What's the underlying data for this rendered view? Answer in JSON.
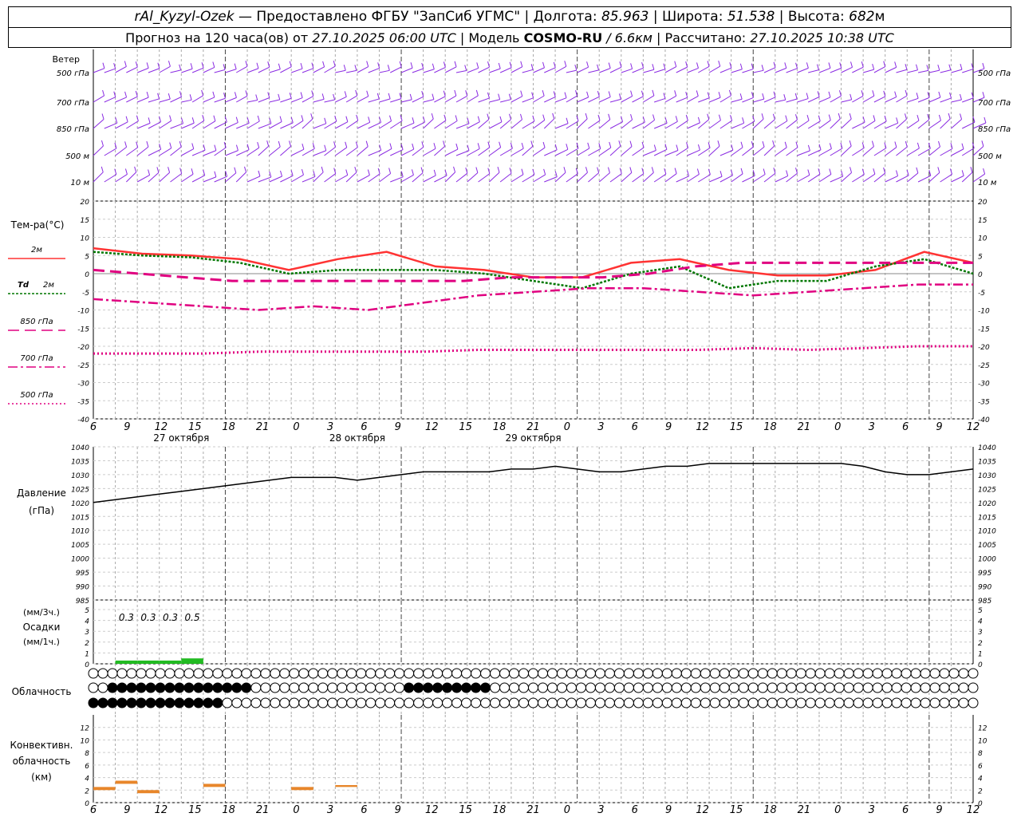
{
  "header": {
    "station": "rAl_Kyzyl-Ozek",
    "provider": " — Предоставлено ФГБУ \"ЗапСиб УГМС\" | Долгота: ",
    "lon": "85.963",
    "lat_label": " | Широта: ",
    "lat": "51.538",
    "alt_label": " | Высота: ",
    "alt": "682",
    "alt_unit": "м",
    "fc_label": "Прогноз на 120 часа(ов) от ",
    "fc_time": "27.10.2025 06:00 UTC",
    "model_label": " | Модель ",
    "model": "COSMO-RU",
    "model_res": " / 6.6км",
    "calc_label": " | Рассчитано: ",
    "calc_time": "27.10.2025 10:38 UTC"
  },
  "time_axis": {
    "ticks": [
      "6",
      "9",
      "12",
      "15",
      "18",
      "21",
      "0",
      "3",
      "6",
      "9",
      "12",
      "15",
      "18",
      "21",
      "0",
      "3",
      "6",
      "9",
      "12",
      "15",
      "18",
      "21",
      "0",
      "3",
      "6",
      "9",
      "12"
    ],
    "dates": [
      "27 октября",
      "28 октября",
      "29 октября"
    ]
  },
  "wind": {
    "title": "Ветер",
    "levels": [
      "500 гПа",
      "700 гПа",
      "850 гПа",
      "500 м",
      "10  м"
    ]
  },
  "labels": {
    "temp": "Тем-ра(°С)",
    "t2m": "2м",
    "td": "Td",
    "td2": "2м",
    "t850": "850 гПа",
    "t700": "700 гПа",
    "t500": "500 гПа",
    "pres1": "Давление",
    "pres2": "(гПа)",
    "precip1": "(мм/3ч.)",
    "precip2": "Осадки",
    "precip3": "(мм/1ч.)",
    "cloud": "Облачность",
    "conv1": "Конвективн.",
    "conv2": "облачность",
    "conv3": "(км)"
  },
  "colors": {
    "t2m": "#ff3333",
    "td": "#007700",
    "isobaric": "#e00080",
    "wind": "#8a2be2",
    "pressure": "#000000",
    "precip": "#22bb22",
    "conv": "#e8862a"
  },
  "chart_data": [
    {
      "type": "line",
      "name": "temperature",
      "ylim": [
        -40,
        20
      ],
      "yticks": [
        20,
        15,
        10,
        5,
        0,
        -5,
        -10,
        -15,
        -20,
        -25,
        -30,
        -35,
        -40
      ],
      "x": [
        0,
        6,
        12,
        18,
        24,
        30,
        36,
        42,
        48,
        54,
        60,
        66,
        72,
        78,
        84,
        90,
        96,
        102,
        108,
        114,
        120
      ],
      "series": [
        {
          "name": "2м",
          "values": [
            7,
            5.5,
            5,
            4,
            1,
            4,
            6,
            2,
            1,
            -1,
            -1,
            3,
            4,
            1,
            -0.5,
            -0.5,
            1,
            6,
            3
          ]
        },
        {
          "name": "Td 2м",
          "values": [
            6,
            5,
            4.5,
            3,
            0,
            1,
            1,
            1,
            0,
            -2,
            -4,
            0,
            2,
            -4,
            -2,
            -2,
            2,
            4,
            0
          ]
        },
        {
          "name": "850 гПа",
          "values": [
            1,
            0,
            -1,
            -2,
            -2,
            -2,
            -2,
            -2,
            -2,
            -1,
            -1,
            -1,
            0,
            2,
            3,
            3,
            3,
            3,
            3,
            3
          ]
        },
        {
          "name": "700 гПа",
          "values": [
            -7,
            -8,
            -9,
            -10,
            -9,
            -10,
            -8,
            -6,
            -5,
            -4,
            -4,
            -5,
            -6,
            -5,
            -4,
            -3,
            -3
          ]
        },
        {
          "name": "500 гПа",
          "values": [
            -22,
            -22,
            -22,
            -21.5,
            -21.5,
            -21.5,
            -21.5,
            -21,
            -21,
            -21,
            -21,
            -21,
            -20.5,
            -21,
            -20.5,
            -20,
            -20
          ]
        }
      ]
    },
    {
      "type": "line",
      "name": "Давление",
      "ylim": [
        985,
        1040
      ],
      "yticks": [
        1040,
        1035,
        1030,
        1025,
        1020,
        1015,
        1010,
        1005,
        1000,
        995,
        990,
        985
      ],
      "x": [
        0,
        3,
        6,
        9,
        12,
        15,
        18,
        21,
        24,
        27,
        30,
        33,
        36,
        39,
        42,
        45,
        48,
        51,
        54,
        57,
        60,
        63,
        66,
        69,
        72,
        75,
        78,
        81,
        84,
        87,
        90,
        93,
        96,
        99,
        102,
        105,
        108,
        111,
        114,
        117,
        120
      ],
      "values": [
        1020,
        1021,
        1022,
        1023,
        1024,
        1025,
        1026,
        1027,
        1028,
        1029,
        1029,
        1029,
        1028,
        1029,
        1030,
        1031,
        1031,
        1031,
        1031,
        1032,
        1032,
        1033,
        1032,
        1031,
        1031,
        1032,
        1033,
        1033,
        1034,
        1034,
        1034,
        1034,
        1034,
        1034,
        1034,
        1033,
        1031,
        1030,
        1030,
        1031,
        1032
      ]
    },
    {
      "type": "bar",
      "name": "Осадки",
      "ylim": [
        0,
        5
      ],
      "yticks": [
        5,
        4,
        3,
        2,
        1,
        0
      ],
      "x": [
        4.5,
        7.5,
        10.5,
        13.5
      ],
      "values": [
        0.3,
        0.3,
        0.3,
        0.5
      ],
      "labels": [
        "0.3",
        "0.3",
        "0.3",
        "0.5"
      ]
    },
    {
      "type": "bar",
      "name": "Конвективн. облачность",
      "ylim": [
        0,
        14
      ],
      "yticks": [
        12,
        10,
        8,
        6,
        4,
        2,
        0
      ],
      "bands": [
        [
          0,
          2,
          2.5
        ],
        [
          3,
          3,
          3.5
        ],
        [
          6,
          1.5,
          2
        ],
        [
          15,
          2.5,
          3
        ],
        [
          27,
          2,
          2.5
        ],
        [
          33,
          2.5,
          2.8
        ]
      ]
    }
  ]
}
